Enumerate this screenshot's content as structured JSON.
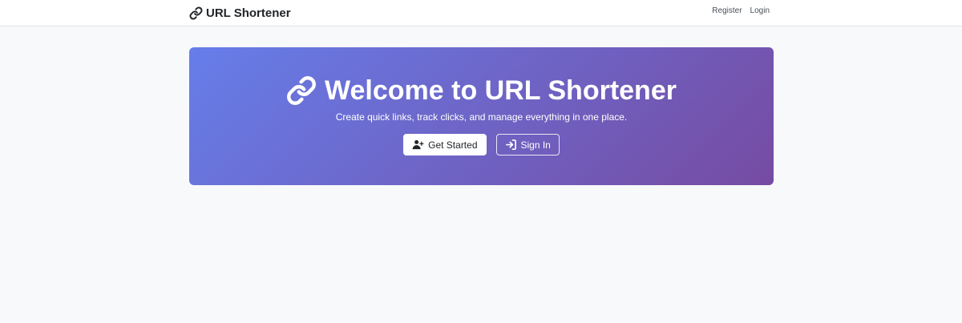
{
  "navbar": {
    "brand_label": "URL Shortener",
    "brand_icon": "link-icon",
    "links": [
      {
        "label": "Register"
      },
      {
        "label": "Login"
      }
    ]
  },
  "hero": {
    "title": "Welcome to URL Shortener",
    "title_icon": "link-icon",
    "subtitle": "Create quick links, track clicks, and manage everything in one place.",
    "primary_button": {
      "label": "Get Started",
      "icon": "user-plus-icon"
    },
    "secondary_button": {
      "label": "Sign In",
      "icon": "sign-in-icon"
    },
    "gradient_start": "#667eea",
    "gradient_end": "#764ba2"
  }
}
